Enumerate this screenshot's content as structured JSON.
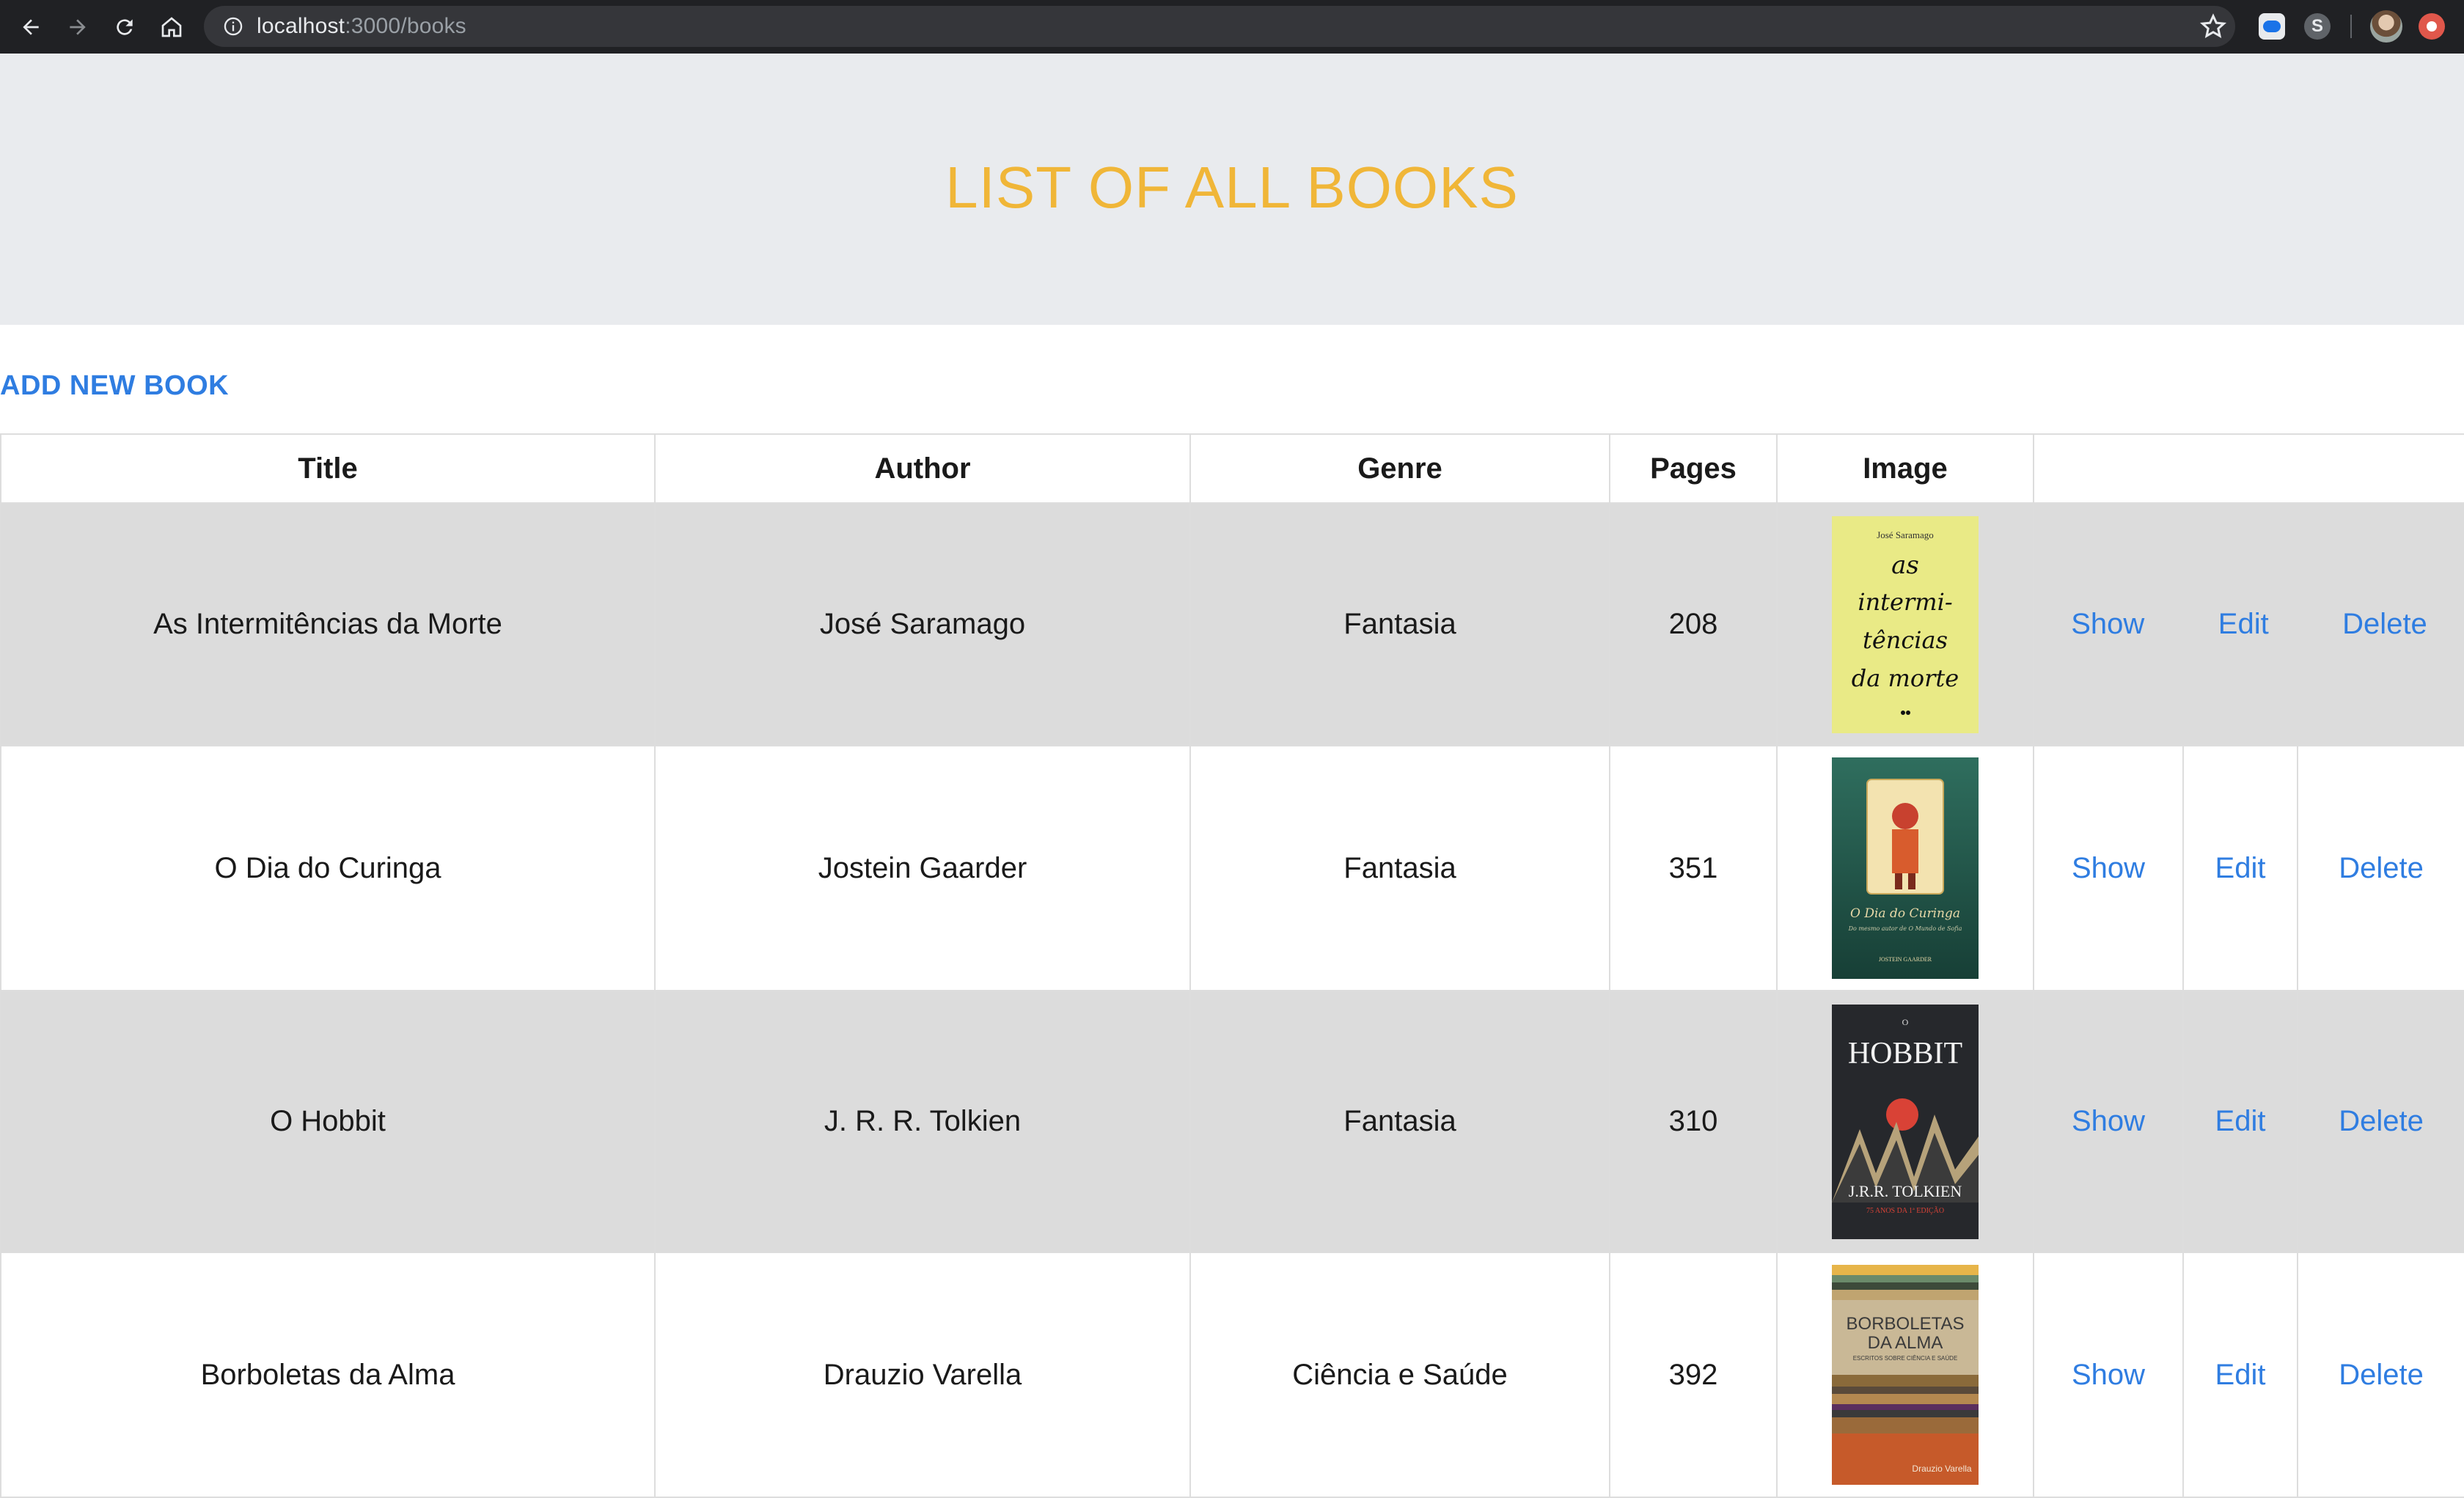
{
  "browser": {
    "url_host": "localhost",
    "url_path": ":3000/books"
  },
  "page": {
    "heading": "LIST OF ALL BOOKS",
    "add_link": "ADD NEW BOOK"
  },
  "table": {
    "headers": [
      "Title",
      "Author",
      "Genre",
      "Pages",
      "Image",
      ""
    ],
    "actions": {
      "show": "Show",
      "edit": "Edit",
      "delete": "Delete"
    },
    "rows": [
      {
        "title": "As Intermitências da Morte",
        "author": "José Saramago",
        "genre": "Fantasia",
        "pages": "208"
      },
      {
        "title": "O Dia do Curinga",
        "author": "Jostein Gaarder",
        "genre": "Fantasia",
        "pages": "351"
      },
      {
        "title": "O Hobbit",
        "author": "J. R. R. Tolkien",
        "genre": "Fantasia",
        "pages": "310"
      },
      {
        "title": "Borboletas da Alma",
        "author": "Drauzio Varella",
        "genre": "Ciência e Saúde",
        "pages": "392"
      }
    ]
  },
  "covers": {
    "saramago": {
      "top_text": "José Saramago",
      "lines": [
        "as",
        "intermi-",
        "tências",
        "da morte"
      ],
      "color": "#e9ea86"
    },
    "gaarder": {
      "title": "O Dia do Curinga",
      "subtitle": "Do mesmo autor de O Mundo de Sofia",
      "author": "JOSTEIN GAARDER",
      "color": "#1f5a4c"
    },
    "hobbit": {
      "small": "O",
      "title": "HOBBIT",
      "author": "J.R.R. TOLKIEN",
      "edition": "75 ANOS DA 1ª EDIÇÃO",
      "color": "#26282c"
    },
    "varella": {
      "title_line1": "BORBOLETAS",
      "title_line2": "DA ALMA",
      "subtitle": "ESCRITOS SOBRE CIÊNCIA E SAÚDE",
      "author": "Drauzio Varella"
    }
  },
  "icons": [
    "back-arrow-icon",
    "forward-arrow-icon",
    "reload-icon",
    "home-icon",
    "info-icon",
    "star-icon"
  ]
}
